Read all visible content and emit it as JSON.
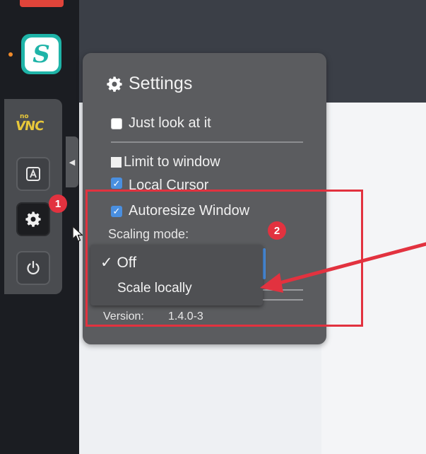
{
  "colors": {
    "accent": "#4a8fe0",
    "annotation_red": "#e2323f",
    "panel_bg": "#5b5c5f",
    "dock_bg": "#1b1d22"
  },
  "dock": {
    "app_icon": "surfshark-icon",
    "app_letter": "S"
  },
  "novnc": {
    "logo_top": "no",
    "logo_bottom": "VNC",
    "keyboard_icon": "keyboard-icon",
    "settings_icon": "gear-icon",
    "power_icon": "power-icon",
    "handle_glyph": "◀"
  },
  "settings": {
    "title": "Settings",
    "view_only_label": "Just look at it",
    "clip_label": "Limit to window",
    "local_cursor_label": "Local Cursor",
    "resize_label": "Autoresize Window",
    "scaling_label": "Scaling mode:",
    "version_label": "Version:",
    "version_value": "1.4.0-3",
    "view_only_checked": false,
    "clip_checked": false,
    "local_cursor_checked": true,
    "resize_checked": true
  },
  "scaling_dropdown": {
    "selected_index": 0,
    "options": [
      {
        "label": "Off",
        "checkmark": "✓"
      },
      {
        "label": "Scale locally"
      }
    ]
  },
  "annotations": {
    "badge_1": "1",
    "badge_2": "2"
  }
}
